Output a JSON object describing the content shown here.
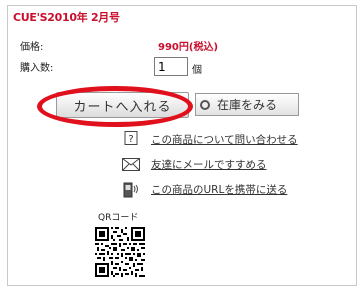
{
  "product": {
    "title": "CUE'S2010年 2月号",
    "price_label": "価格:",
    "price_value": "990円(税込)",
    "quantity_label": "購入数:",
    "quantity_value": "1",
    "quantity_unit": "個"
  },
  "actions": {
    "add_to_cart": "カートへ入れる",
    "check_stock": "在庫をみる"
  },
  "links": [
    {
      "icon": "question-icon",
      "label": "この商品について問い合わせる"
    },
    {
      "icon": "envelope-icon",
      "label": "友達にメールですすめる"
    },
    {
      "icon": "mobile-phone-icon",
      "label": "この商品のURLを携帯に送る"
    }
  ],
  "qr": {
    "label": "QRコード"
  },
  "colors": {
    "accent": "#c8102e",
    "highlight": "#e0101c"
  }
}
